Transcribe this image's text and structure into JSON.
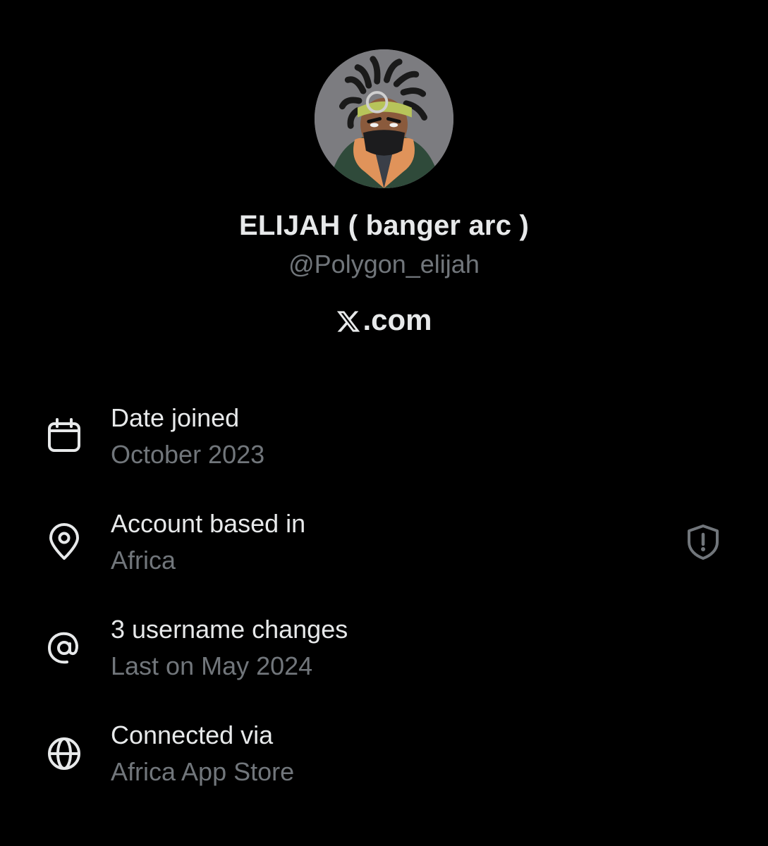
{
  "profile": {
    "display_name": "ELIJAH ( banger arc )",
    "handle": "@Polygon_elijah",
    "site_text": ".com",
    "site_logo_icon": "x-logo-icon"
  },
  "details": [
    {
      "icon": "calendar-icon",
      "title": "Date joined",
      "value": "October 2023"
    },
    {
      "icon": "location-pin-icon",
      "title": "Account based in",
      "value": "Africa",
      "badge_icon": "shield-alert-icon"
    },
    {
      "icon": "at-sign-icon",
      "title": "3 username changes",
      "value": "Last on May 2024"
    },
    {
      "icon": "globe-icon",
      "title": "Connected via",
      "value": "Africa App Store"
    }
  ],
  "colors": {
    "background": "#000000",
    "primary_text": "#e7e9ea",
    "secondary_text": "#71767b"
  }
}
